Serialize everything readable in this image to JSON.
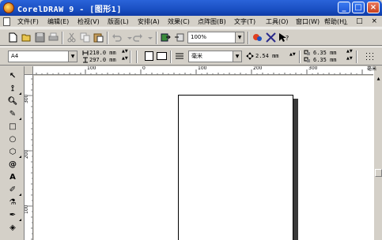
{
  "window": {
    "title": "CorelDRAW 9 - [图形1]",
    "controls": {
      "minimize": "_",
      "maximize": "□",
      "close": "×"
    },
    "mdi_controls": "_ □ ×"
  },
  "menu": {
    "items": [
      "文件(F)",
      "编辑(E)",
      "检视(V)",
      "版面(L)",
      "安排(A)",
      "效果(C)",
      "点阵图(B)",
      "文字(T)",
      "工具(O)",
      "窗口(W)",
      "帮助(H)"
    ]
  },
  "standard_toolbar": {
    "zoom": "100%"
  },
  "property_bar": {
    "paper": "A4",
    "width": "210.0 mm",
    "height": "297.0 mm",
    "units": "毫米",
    "nudge": "2.54 mm",
    "dup_x": "6.35 mm",
    "dup_y": "6.35 mm"
  },
  "rulers": {
    "corner": "毫米",
    "horizontal_labels": [
      "100",
      "0",
      "100",
      "200",
      "300"
    ],
    "vertical_labels": [
      "300",
      "200",
      "100"
    ],
    "units": "毫米"
  },
  "colors": {
    "titlebar": "#1a4fc2",
    "chrome": "#d4d0c8",
    "canvas": "#ffffff"
  }
}
